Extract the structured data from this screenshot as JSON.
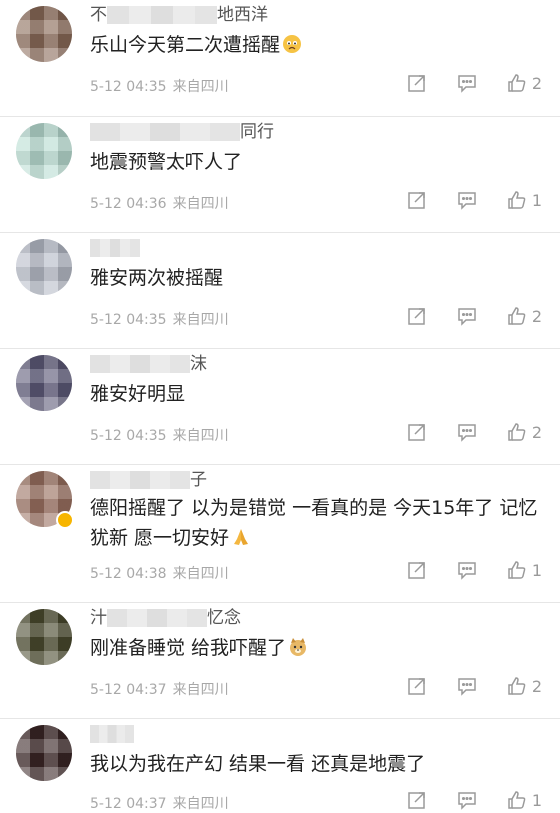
{
  "comments": [
    {
      "name_prefix": "不",
      "name_suffix": "地西洋",
      "text": "乐山今天第二次遭摇醒",
      "emoji": "worried-face-emoji",
      "time": "5-12 04:35",
      "source": "来自四川",
      "likes": "2",
      "avatar_color": "#8a6a58"
    },
    {
      "name_prefix": "",
      "name_suffix": "同行",
      "text": "地震预警太吓人了",
      "emoji": "",
      "time": "5-12 04:36",
      "source": "来自四川",
      "likes": "1",
      "avatar_color": "#b9ddd2"
    },
    {
      "name_prefix": "",
      "name_suffix": "",
      "text": "雅安两次被摇醒",
      "emoji": "",
      "time": "5-12 04:35",
      "source": "来自四川",
      "likes": "2",
      "avatar_color": "#b7bcc8"
    },
    {
      "name_prefix": "",
      "name_suffix": "沫",
      "text": "雅安好明显",
      "emoji": "",
      "time": "5-12 04:35",
      "source": "来自四川",
      "likes": "2",
      "avatar_color": "#5d5a78"
    },
    {
      "name_prefix": "",
      "name_suffix": "子",
      "text": "德阳摇醒了 以为是错觉 一看真的是 今天15年了 记忆犹新 愿一切安好",
      "emoji": "pray-hands-emoji",
      "time": "5-12 04:38",
      "source": "来自四川",
      "likes": "1",
      "avatar_color": "#9a7060"
    },
    {
      "name_prefix": "汁",
      "name_suffix": "忆念",
      "text": "刚准备睡觉 给我吓醒了",
      "emoji": "doge-emoji",
      "time": "5-12 04:37",
      "source": "来自四川",
      "likes": "2",
      "avatar_color": "#4a4a2e"
    },
    {
      "name_prefix": "",
      "name_suffix": "",
      "text": "我以为我在产幻   结果一看  还真是地震了",
      "emoji": "",
      "time": "5-12 04:37",
      "source": "来自四川",
      "likes": "1",
      "avatar_color": "#3a2626"
    }
  ],
  "colors": {
    "meta": "#a8a8a8",
    "icon": "#9a9a9a",
    "divider": "#e6e6e6"
  }
}
